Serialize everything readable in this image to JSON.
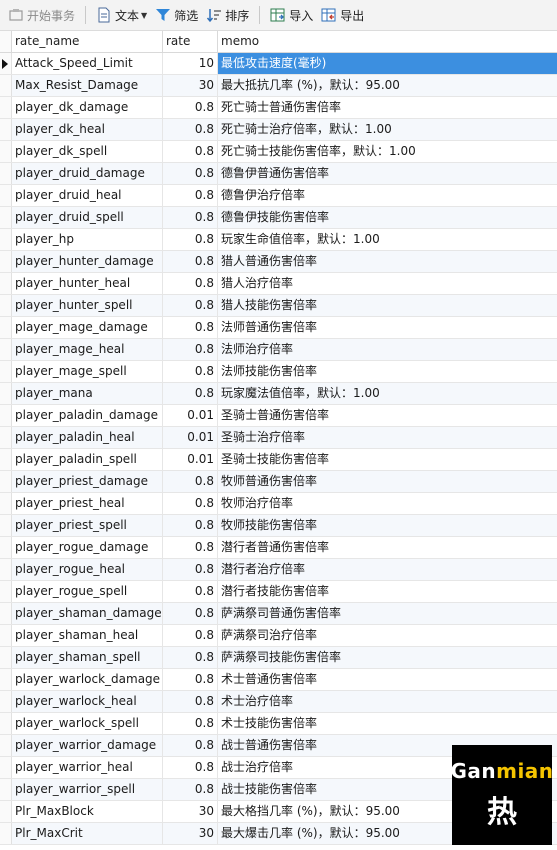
{
  "toolbar": {
    "begin_transaction": "开始事务",
    "text": "文本",
    "filter": "筛选",
    "sort": "排序",
    "import": "导入",
    "export": "导出"
  },
  "columns": {
    "rate_name": "rate_name",
    "rate": "rate",
    "memo": "memo"
  },
  "rows": [
    {
      "name": "Attack_Speed_Limit",
      "rate": "10",
      "memo": "最低攻击速度(毫秒)"
    },
    {
      "name": "Max_Resist_Damage",
      "rate": "30",
      "memo": "最大抵抗几率 (%)，默认：95.00"
    },
    {
      "name": "player_dk_damage",
      "rate": "0.8",
      "memo": "死亡骑士普通伤害倍率"
    },
    {
      "name": "player_dk_heal",
      "rate": "0.8",
      "memo": "死亡骑士治疗倍率，默认：1.00"
    },
    {
      "name": "player_dk_spell",
      "rate": "0.8",
      "memo": "死亡骑士技能伤害倍率，默认：1.00"
    },
    {
      "name": "player_druid_damage",
      "rate": "0.8",
      "memo": "德鲁伊普通伤害倍率"
    },
    {
      "name": "player_druid_heal",
      "rate": "0.8",
      "memo": "德鲁伊治疗倍率"
    },
    {
      "name": "player_druid_spell",
      "rate": "0.8",
      "memo": "德鲁伊技能伤害倍率"
    },
    {
      "name": "player_hp",
      "rate": "0.8",
      "memo": "玩家生命值倍率，默认：1.00"
    },
    {
      "name": "player_hunter_damage",
      "rate": "0.8",
      "memo": "猎人普通伤害倍率"
    },
    {
      "name": "player_hunter_heal",
      "rate": "0.8",
      "memo": "猎人治疗倍率"
    },
    {
      "name": "player_hunter_spell",
      "rate": "0.8",
      "memo": "猎人技能伤害倍率"
    },
    {
      "name": "player_mage_damage",
      "rate": "0.8",
      "memo": "法师普通伤害倍率"
    },
    {
      "name": "player_mage_heal",
      "rate": "0.8",
      "memo": "法师治疗倍率"
    },
    {
      "name": "player_mage_spell",
      "rate": "0.8",
      "memo": "法师技能伤害倍率"
    },
    {
      "name": "player_mana",
      "rate": "0.8",
      "memo": "玩家魔法值倍率，默认：1.00"
    },
    {
      "name": "player_paladin_damage",
      "rate": "0.01",
      "memo": "圣骑士普通伤害倍率"
    },
    {
      "name": "player_paladin_heal",
      "rate": "0.01",
      "memo": "圣骑士治疗倍率"
    },
    {
      "name": "player_paladin_spell",
      "rate": "0.01",
      "memo": "圣骑士技能伤害倍率"
    },
    {
      "name": "player_priest_damage",
      "rate": "0.8",
      "memo": "牧师普通伤害倍率"
    },
    {
      "name": "player_priest_heal",
      "rate": "0.8",
      "memo": "牧师治疗倍率"
    },
    {
      "name": "player_priest_spell",
      "rate": "0.8",
      "memo": "牧师技能伤害倍率"
    },
    {
      "name": "player_rogue_damage",
      "rate": "0.8",
      "memo": "潜行者普通伤害倍率"
    },
    {
      "name": "player_rogue_heal",
      "rate": "0.8",
      "memo": "潜行者治疗倍率"
    },
    {
      "name": "player_rogue_spell",
      "rate": "0.8",
      "memo": "潜行者技能伤害倍率"
    },
    {
      "name": "player_shaman_damage",
      "rate": "0.8",
      "memo": "萨满祭司普通伤害倍率"
    },
    {
      "name": "player_shaman_heal",
      "rate": "0.8",
      "memo": "萨满祭司治疗倍率"
    },
    {
      "name": "player_shaman_spell",
      "rate": "0.8",
      "memo": "萨满祭司技能伤害倍率"
    },
    {
      "name": "player_warlock_damage",
      "rate": "0.8",
      "memo": "术士普通伤害倍率"
    },
    {
      "name": "player_warlock_heal",
      "rate": "0.8",
      "memo": "术士治疗倍率"
    },
    {
      "name": "player_warlock_spell",
      "rate": "0.8",
      "memo": "术士技能伤害倍率"
    },
    {
      "name": "player_warrior_damage",
      "rate": "0.8",
      "memo": "战士普通伤害倍率"
    },
    {
      "name": "player_warrior_heal",
      "rate": "0.8",
      "memo": "战士治疗倍率"
    },
    {
      "name": "player_warrior_spell",
      "rate": "0.8",
      "memo": "战士技能伤害倍率"
    },
    {
      "name": "Plr_MaxBlock",
      "rate": "30",
      "memo": "最大格挡几率 (%)，默认：95.00"
    },
    {
      "name": "Plr_MaxCrit",
      "rate": "30",
      "memo": "最大爆击几率 (%)，默认：95.00"
    }
  ],
  "watermark": {
    "part1": "Gan",
    "part2": "mian",
    "char": "热"
  }
}
